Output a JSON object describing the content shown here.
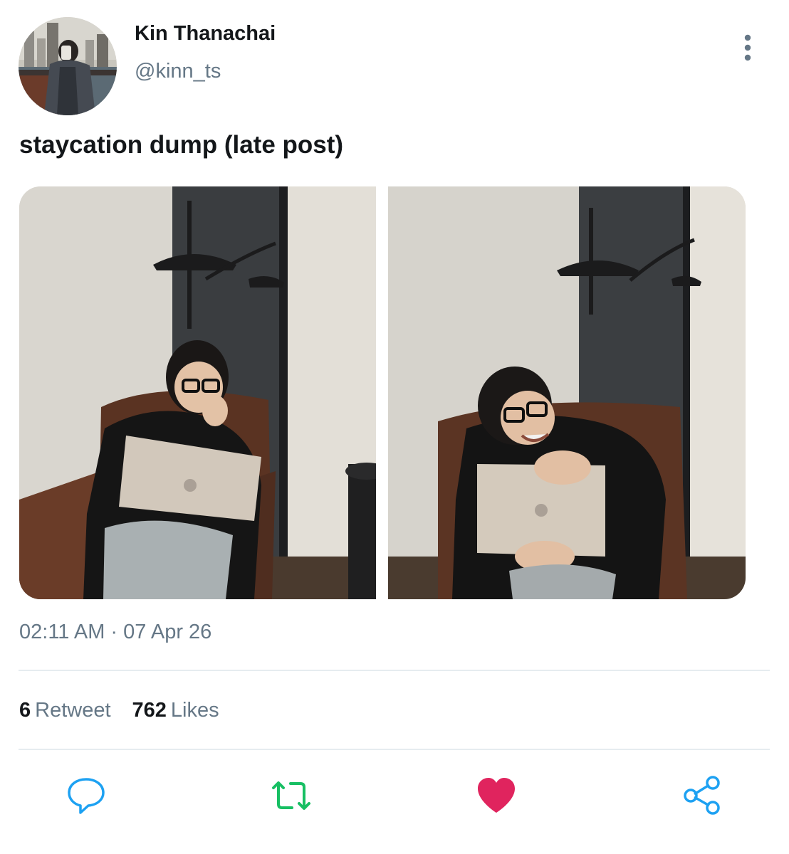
{
  "author": {
    "display_name": "Kin Thanachai",
    "handle": "@kinn_ts",
    "avatar_icon": "profile-photo"
  },
  "menu": {
    "icon": "more-vertical-icon"
  },
  "tweet": {
    "text": "staycation dump (late post)",
    "timestamp": "02:11 AM · 07 Apr 26",
    "media_count": 2
  },
  "stats": {
    "retweets": {
      "count": "6",
      "label": "Retweet"
    },
    "likes": {
      "count": "762",
      "label": "Likes"
    }
  },
  "actions": [
    {
      "icon": "reply-icon",
      "color": "#1da1f2"
    },
    {
      "icon": "retweet-icon",
      "color": "#17bf63"
    },
    {
      "icon": "heart-icon",
      "color": "#e0245e",
      "active": true
    },
    {
      "icon": "share-icon",
      "color": "#1da1f2"
    }
  ],
  "colors": {
    "text_primary": "#14171a",
    "text_secondary": "#657786",
    "divider": "#e6ecf0"
  }
}
